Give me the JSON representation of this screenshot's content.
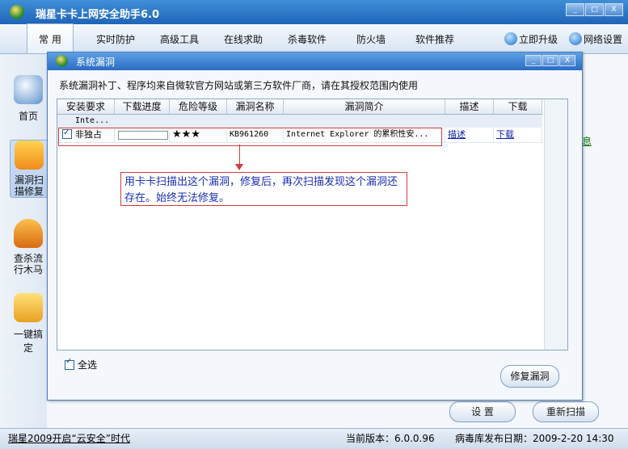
{
  "app": {
    "title": "瑞星卡卡上网安全助手6.0"
  },
  "window_buttons": {
    "minimize": "_",
    "maximize": "□",
    "close": "X"
  },
  "nav": {
    "tabs": [
      {
        "label": "常 用"
      },
      {
        "label": "实时防护"
      },
      {
        "label": "高级工具"
      },
      {
        "label": "在线求助"
      },
      {
        "label": "杀毒软件"
      },
      {
        "label": "防火墙"
      },
      {
        "label": "软件推荐"
      }
    ],
    "upgrade_label": "立即升级",
    "settings_label": "网络设置"
  },
  "sidebar": {
    "items": [
      {
        "label": "首页",
        "icon": "home-icon"
      },
      {
        "label": "漏洞扫描修复",
        "icon": "shield-patch-icon"
      },
      {
        "label": "查杀流行木马",
        "icon": "shield-scan-icon"
      },
      {
        "label": "一键搞定",
        "icon": "one-click-icon"
      }
    ]
  },
  "main": {
    "right_link": "息",
    "settings_button": "设 置",
    "rescan_button": "重新扫描"
  },
  "dialog": {
    "title": "系统漏洞",
    "notice": "系统漏洞补丁、程序均来自微软官方网站或第三方软件厂商，请在其授权范围内使用",
    "columns": [
      "安装要求",
      "下载进度",
      "危险等级",
      "漏洞名称",
      "漏洞简介",
      "描述",
      "下载"
    ],
    "group_label": "Inte...",
    "rows": [
      {
        "checked": true,
        "install_req": "非独占",
        "progress": 0,
        "danger": "★★★",
        "name": "KB961260",
        "summary": "Internet Explorer 的累积性安...",
        "describe": "描述",
        "download": "下载"
      }
    ],
    "annotation": "用卡卡扫描出这个漏洞，修复后，再次扫描发现这个漏洞还存在。始终无法修复。",
    "select_all": "全选",
    "repair_button": "修复漏洞"
  },
  "status": {
    "promo": "瑞星2009开启“云安全”时代",
    "version": "当前版本：6.0.0.96",
    "db_date": "病毒库发布日期：2009-2-20 14:30"
  },
  "colors": {
    "titlebar": "#2a6cc1",
    "annotation_border": "#d23b3b",
    "annotation_text": "#1a2fb5"
  }
}
